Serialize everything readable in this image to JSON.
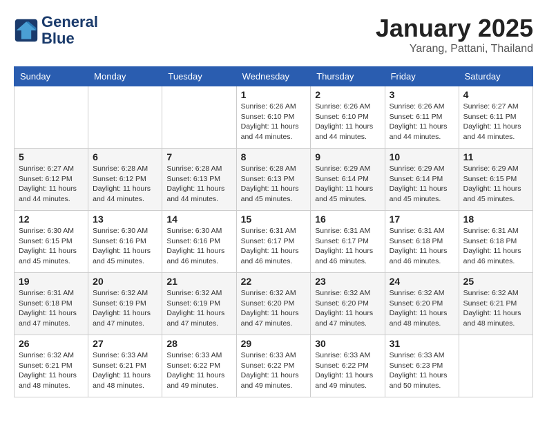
{
  "header": {
    "logo_line1": "General",
    "logo_line2": "Blue",
    "month": "January 2025",
    "location": "Yarang, Pattani, Thailand"
  },
  "weekdays": [
    "Sunday",
    "Monday",
    "Tuesday",
    "Wednesday",
    "Thursday",
    "Friday",
    "Saturday"
  ],
  "weeks": [
    [
      {
        "day": "",
        "info": ""
      },
      {
        "day": "",
        "info": ""
      },
      {
        "day": "",
        "info": ""
      },
      {
        "day": "1",
        "info": "Sunrise: 6:26 AM\nSunset: 6:10 PM\nDaylight: 11 hours\nand 44 minutes."
      },
      {
        "day": "2",
        "info": "Sunrise: 6:26 AM\nSunset: 6:10 PM\nDaylight: 11 hours\nand 44 minutes."
      },
      {
        "day": "3",
        "info": "Sunrise: 6:26 AM\nSunset: 6:11 PM\nDaylight: 11 hours\nand 44 minutes."
      },
      {
        "day": "4",
        "info": "Sunrise: 6:27 AM\nSunset: 6:11 PM\nDaylight: 11 hours\nand 44 minutes."
      }
    ],
    [
      {
        "day": "5",
        "info": "Sunrise: 6:27 AM\nSunset: 6:12 PM\nDaylight: 11 hours\nand 44 minutes."
      },
      {
        "day": "6",
        "info": "Sunrise: 6:28 AM\nSunset: 6:12 PM\nDaylight: 11 hours\nand 44 minutes."
      },
      {
        "day": "7",
        "info": "Sunrise: 6:28 AM\nSunset: 6:13 PM\nDaylight: 11 hours\nand 44 minutes."
      },
      {
        "day": "8",
        "info": "Sunrise: 6:28 AM\nSunset: 6:13 PM\nDaylight: 11 hours\nand 45 minutes."
      },
      {
        "day": "9",
        "info": "Sunrise: 6:29 AM\nSunset: 6:14 PM\nDaylight: 11 hours\nand 45 minutes."
      },
      {
        "day": "10",
        "info": "Sunrise: 6:29 AM\nSunset: 6:14 PM\nDaylight: 11 hours\nand 45 minutes."
      },
      {
        "day": "11",
        "info": "Sunrise: 6:29 AM\nSunset: 6:15 PM\nDaylight: 11 hours\nand 45 minutes."
      }
    ],
    [
      {
        "day": "12",
        "info": "Sunrise: 6:30 AM\nSunset: 6:15 PM\nDaylight: 11 hours\nand 45 minutes."
      },
      {
        "day": "13",
        "info": "Sunrise: 6:30 AM\nSunset: 6:16 PM\nDaylight: 11 hours\nand 45 minutes."
      },
      {
        "day": "14",
        "info": "Sunrise: 6:30 AM\nSunset: 6:16 PM\nDaylight: 11 hours\nand 46 minutes."
      },
      {
        "day": "15",
        "info": "Sunrise: 6:31 AM\nSunset: 6:17 PM\nDaylight: 11 hours\nand 46 minutes."
      },
      {
        "day": "16",
        "info": "Sunrise: 6:31 AM\nSunset: 6:17 PM\nDaylight: 11 hours\nand 46 minutes."
      },
      {
        "day": "17",
        "info": "Sunrise: 6:31 AM\nSunset: 6:18 PM\nDaylight: 11 hours\nand 46 minutes."
      },
      {
        "day": "18",
        "info": "Sunrise: 6:31 AM\nSunset: 6:18 PM\nDaylight: 11 hours\nand 46 minutes."
      }
    ],
    [
      {
        "day": "19",
        "info": "Sunrise: 6:31 AM\nSunset: 6:18 PM\nDaylight: 11 hours\nand 47 minutes."
      },
      {
        "day": "20",
        "info": "Sunrise: 6:32 AM\nSunset: 6:19 PM\nDaylight: 11 hours\nand 47 minutes."
      },
      {
        "day": "21",
        "info": "Sunrise: 6:32 AM\nSunset: 6:19 PM\nDaylight: 11 hours\nand 47 minutes."
      },
      {
        "day": "22",
        "info": "Sunrise: 6:32 AM\nSunset: 6:20 PM\nDaylight: 11 hours\nand 47 minutes."
      },
      {
        "day": "23",
        "info": "Sunrise: 6:32 AM\nSunset: 6:20 PM\nDaylight: 11 hours\nand 47 minutes."
      },
      {
        "day": "24",
        "info": "Sunrise: 6:32 AM\nSunset: 6:20 PM\nDaylight: 11 hours\nand 48 minutes."
      },
      {
        "day": "25",
        "info": "Sunrise: 6:32 AM\nSunset: 6:21 PM\nDaylight: 11 hours\nand 48 minutes."
      }
    ],
    [
      {
        "day": "26",
        "info": "Sunrise: 6:32 AM\nSunset: 6:21 PM\nDaylight: 11 hours\nand 48 minutes."
      },
      {
        "day": "27",
        "info": "Sunrise: 6:33 AM\nSunset: 6:21 PM\nDaylight: 11 hours\nand 48 minutes."
      },
      {
        "day": "28",
        "info": "Sunrise: 6:33 AM\nSunset: 6:22 PM\nDaylight: 11 hours\nand 49 minutes."
      },
      {
        "day": "29",
        "info": "Sunrise: 6:33 AM\nSunset: 6:22 PM\nDaylight: 11 hours\nand 49 minutes."
      },
      {
        "day": "30",
        "info": "Sunrise: 6:33 AM\nSunset: 6:22 PM\nDaylight: 11 hours\nand 49 minutes."
      },
      {
        "day": "31",
        "info": "Sunrise: 6:33 AM\nSunset: 6:23 PM\nDaylight: 11 hours\nand 50 minutes."
      },
      {
        "day": "",
        "info": ""
      }
    ]
  ]
}
